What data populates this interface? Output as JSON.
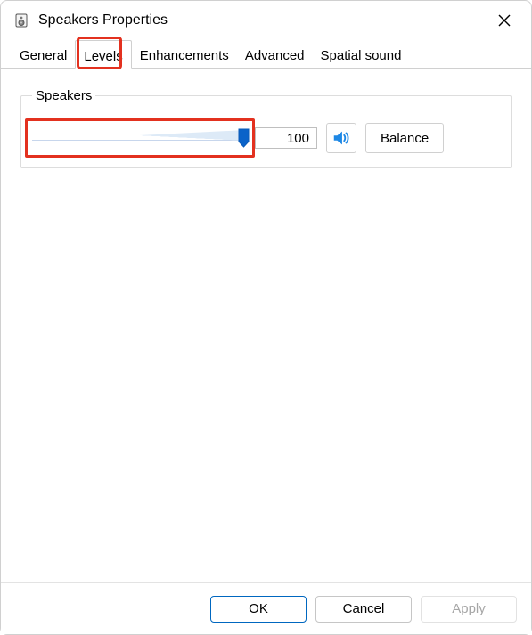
{
  "window": {
    "title": "Speakers Properties"
  },
  "tabs": {
    "items": [
      "General",
      "Levels",
      "Enhancements",
      "Advanced",
      "Spatial sound"
    ],
    "active": "Levels"
  },
  "group": {
    "title": "Speakers",
    "value": "100",
    "slider_percent": 100,
    "balance_label": "Balance"
  },
  "footer": {
    "ok": "OK",
    "cancel": "Cancel",
    "apply": "Apply"
  },
  "colors": {
    "accent": "#0067c0",
    "highlight": "#e3311f"
  },
  "icons": {
    "app": "speaker-cabinet-icon",
    "close": "close-icon",
    "mute": "speaker-icon"
  }
}
